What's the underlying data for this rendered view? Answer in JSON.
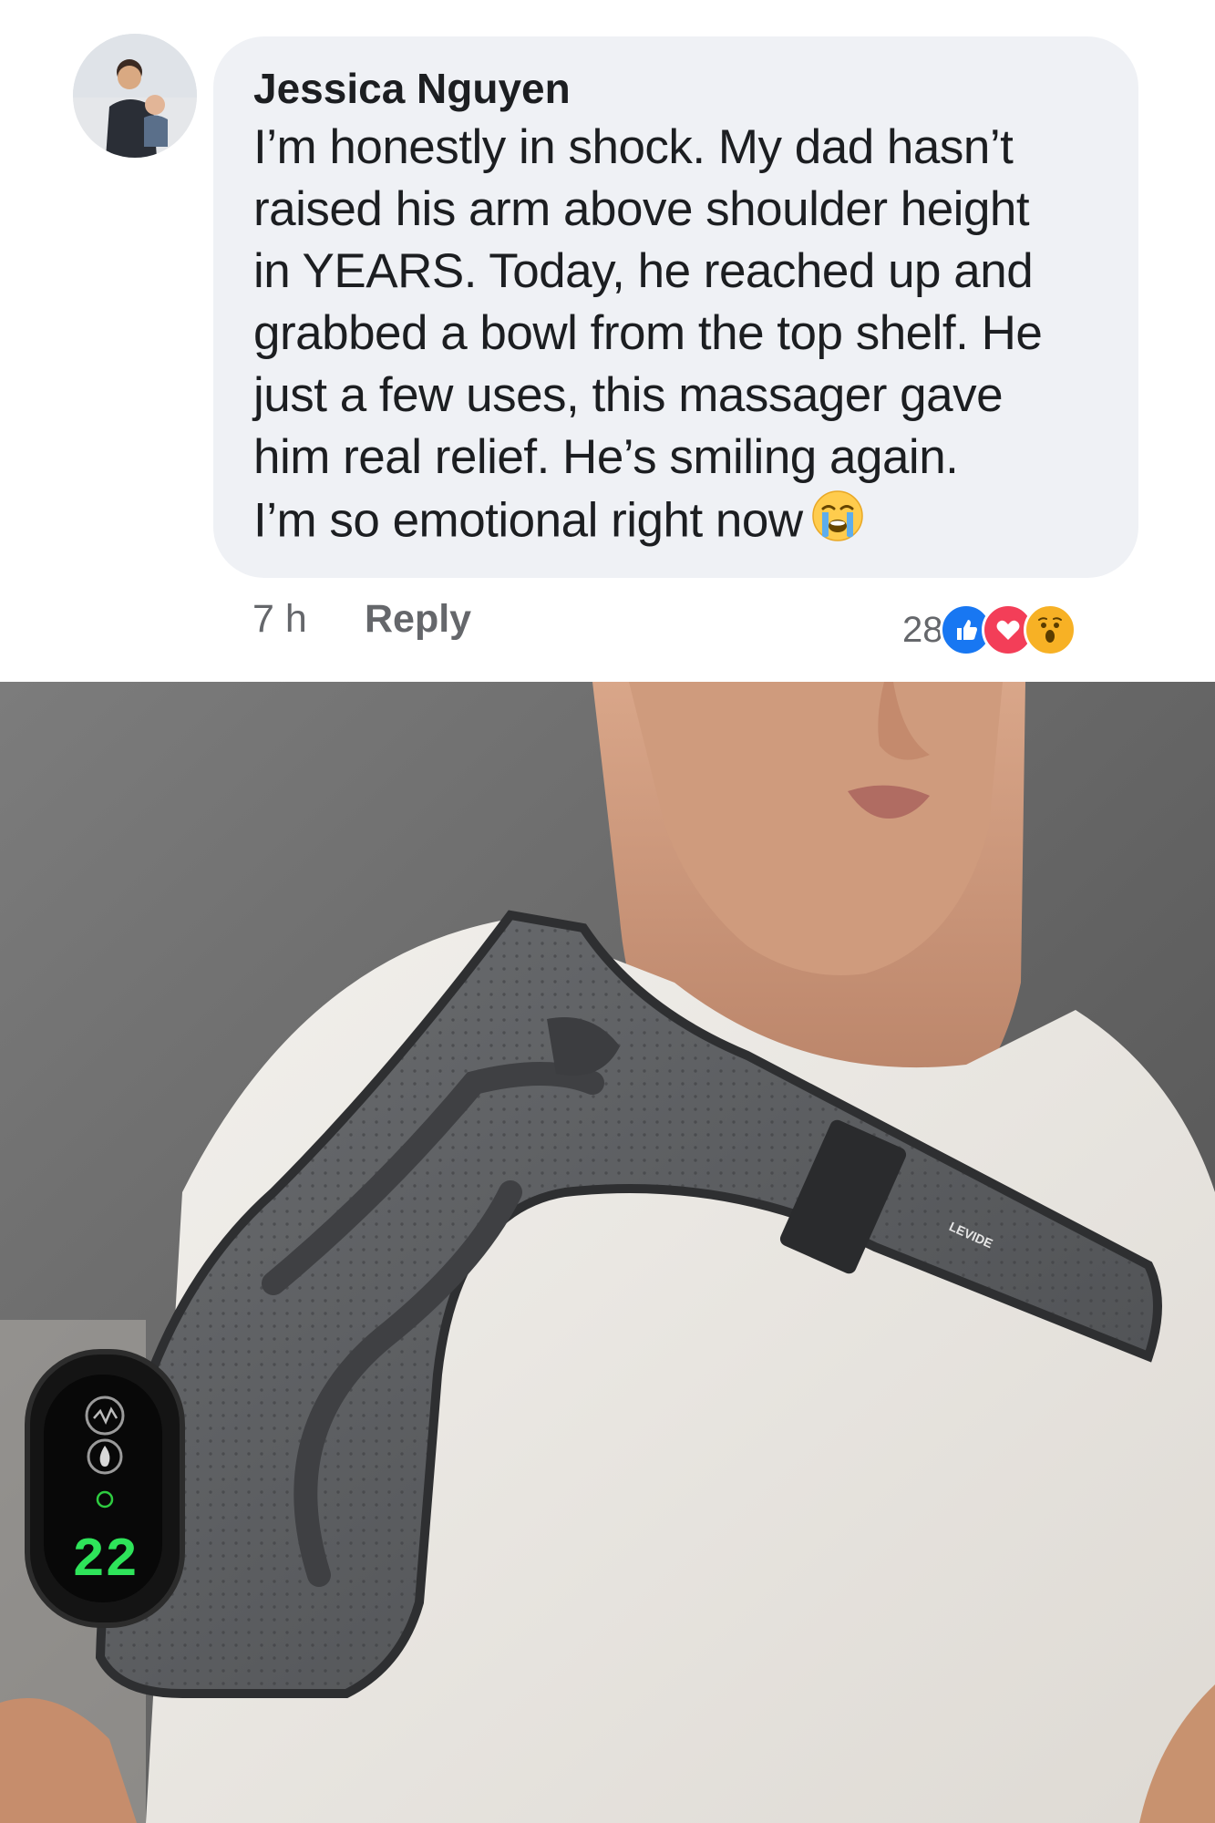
{
  "comment": {
    "author": "Jessica Nguyen",
    "lines": [
      "I’m honestly in shock. My dad hasn’t",
      "raised his arm above shoulder height",
      "in YEARS. Today, he reached up and",
      "grabbed a bowl from the top shelf. He",
      "just a few uses, this massager gave",
      "him real relief. He’s smiling again.",
      "I’m so emotional right now"
    ],
    "time": "7 h",
    "reply_label": "Reply",
    "reaction_count": "28",
    "reactions": [
      "like-icon",
      "love-icon",
      "wow-icon"
    ],
    "colors": {
      "like": "#1877f2",
      "love": "#f33e58",
      "wow": "#f7b125"
    }
  },
  "product": {
    "brand": "LEVIDE",
    "display_value": "22"
  }
}
